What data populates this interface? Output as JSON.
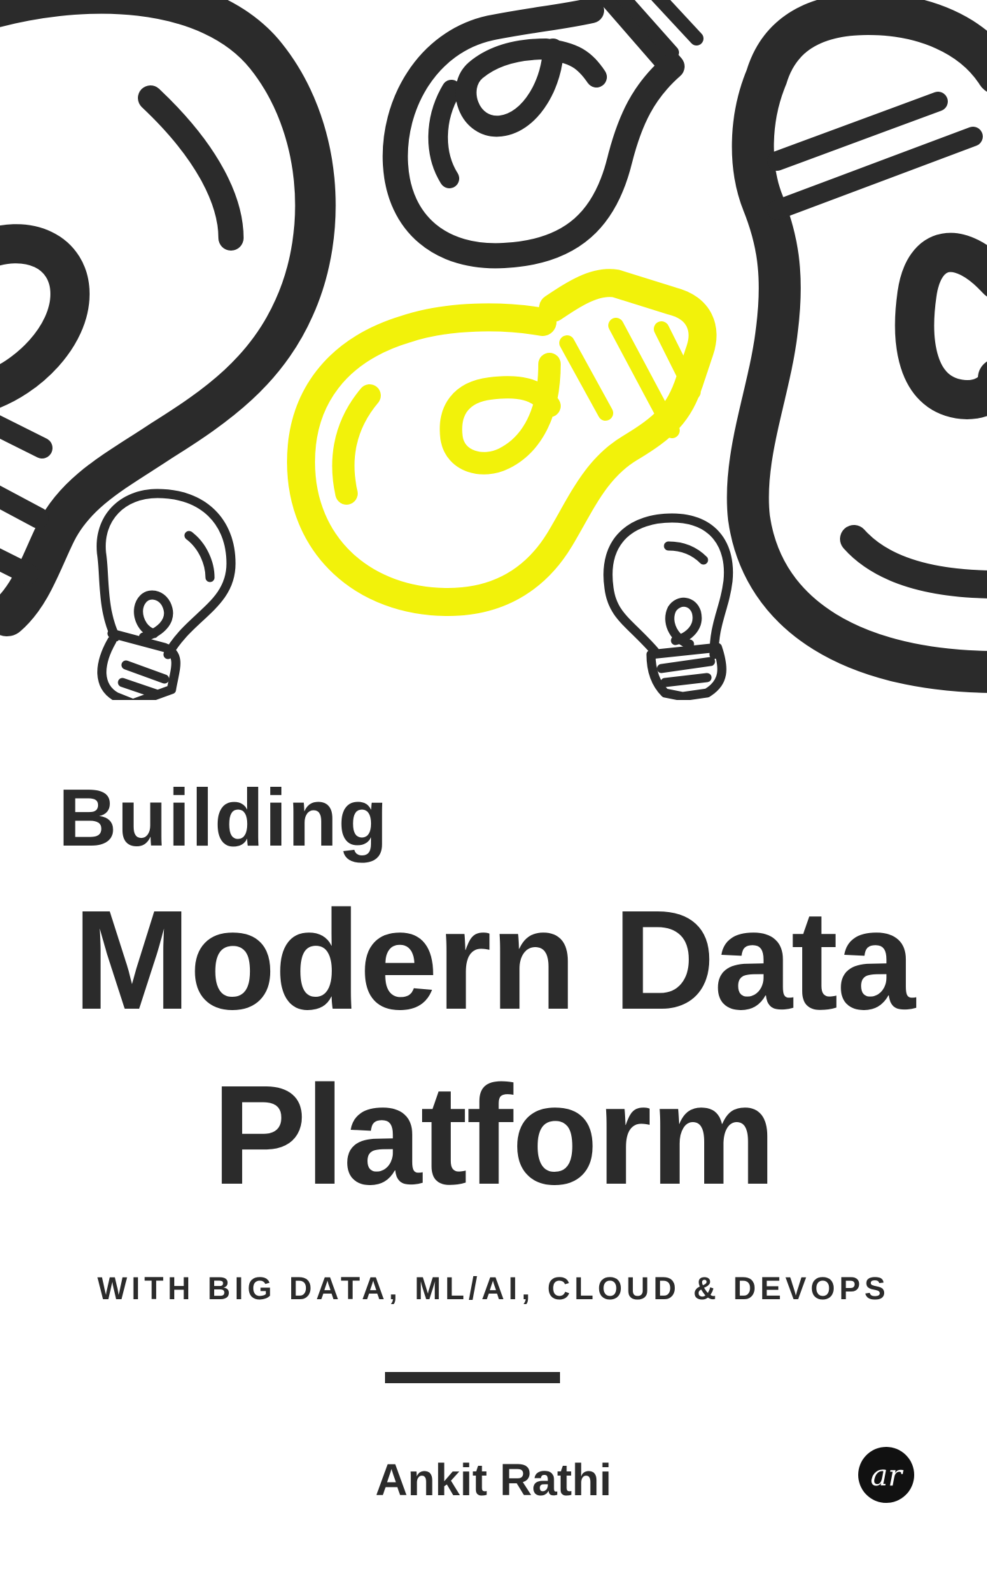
{
  "cover": {
    "title_small": "Building",
    "title_line1": "Modern Data",
    "title_line2": "Platform",
    "subtitle": "WITH BIG DATA, ML/AI, CLOUD & DEVOPS",
    "author": "Ankit Rathi",
    "publisher_logo": "ar"
  },
  "colors": {
    "ink": "#2b2b2b",
    "accent_yellow": "#f2f20a",
    "background": "#ffffff"
  },
  "icons": [
    "lightbulb-icon",
    "lightbulb-icon-yellow"
  ]
}
